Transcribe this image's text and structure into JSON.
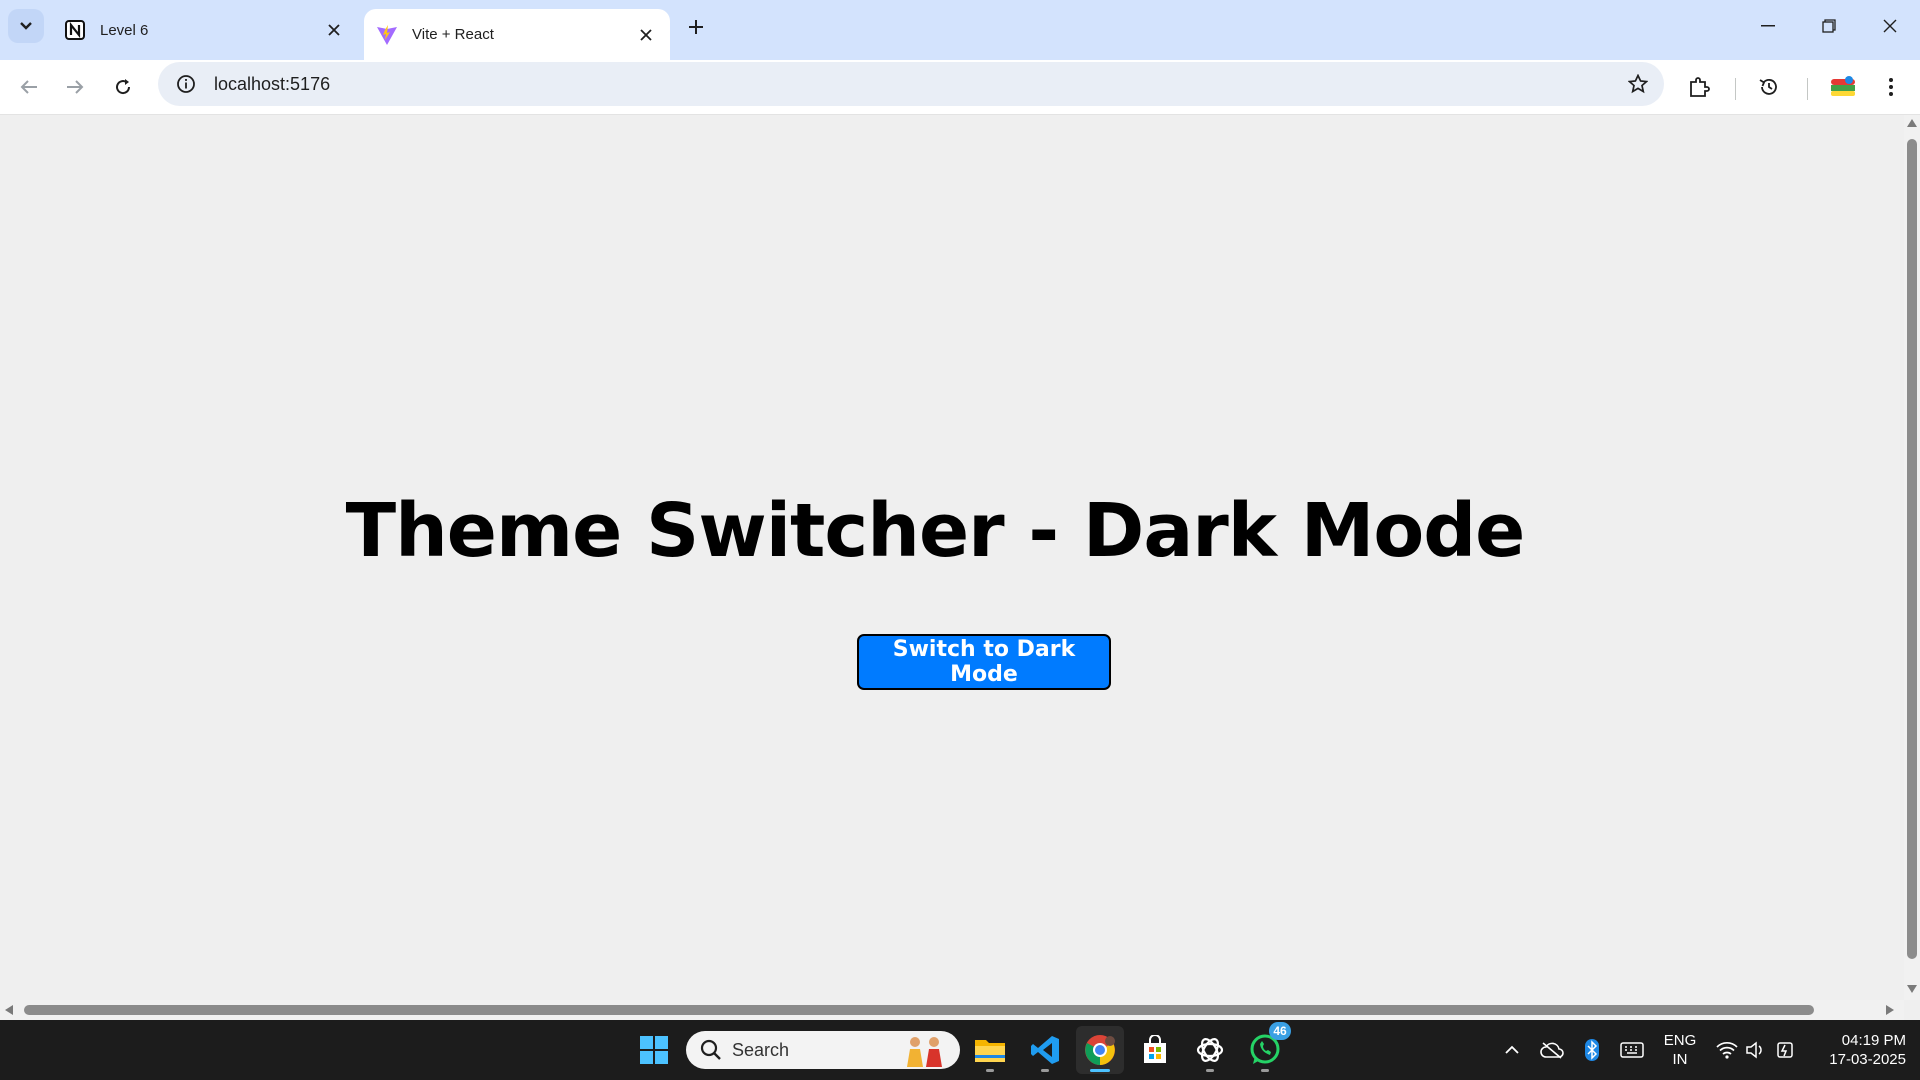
{
  "browser": {
    "tabs": [
      {
        "title": "Level 6",
        "icon": "notion-icon",
        "active": false
      },
      {
        "title": "Vite + React",
        "icon": "vite-icon",
        "active": true
      }
    ],
    "address": "localhost:5176"
  },
  "page": {
    "heading": "Theme Switcher - Dark Mode",
    "button_label": "Switch to Dark Mode",
    "background": "#efefef",
    "button_color": "#007bff"
  },
  "taskbar": {
    "search_placeholder": "Search",
    "apps": [
      "start-icon",
      "file-explorer-icon",
      "vscode-icon",
      "chrome-icon",
      "microsoft-store-icon",
      "chatgpt-icon",
      "whatsapp-icon"
    ],
    "whatsapp_badge": "46",
    "language_line1": "ENG",
    "language_line2": "IN",
    "time": "04:19 PM",
    "date": "17-03-2025"
  }
}
